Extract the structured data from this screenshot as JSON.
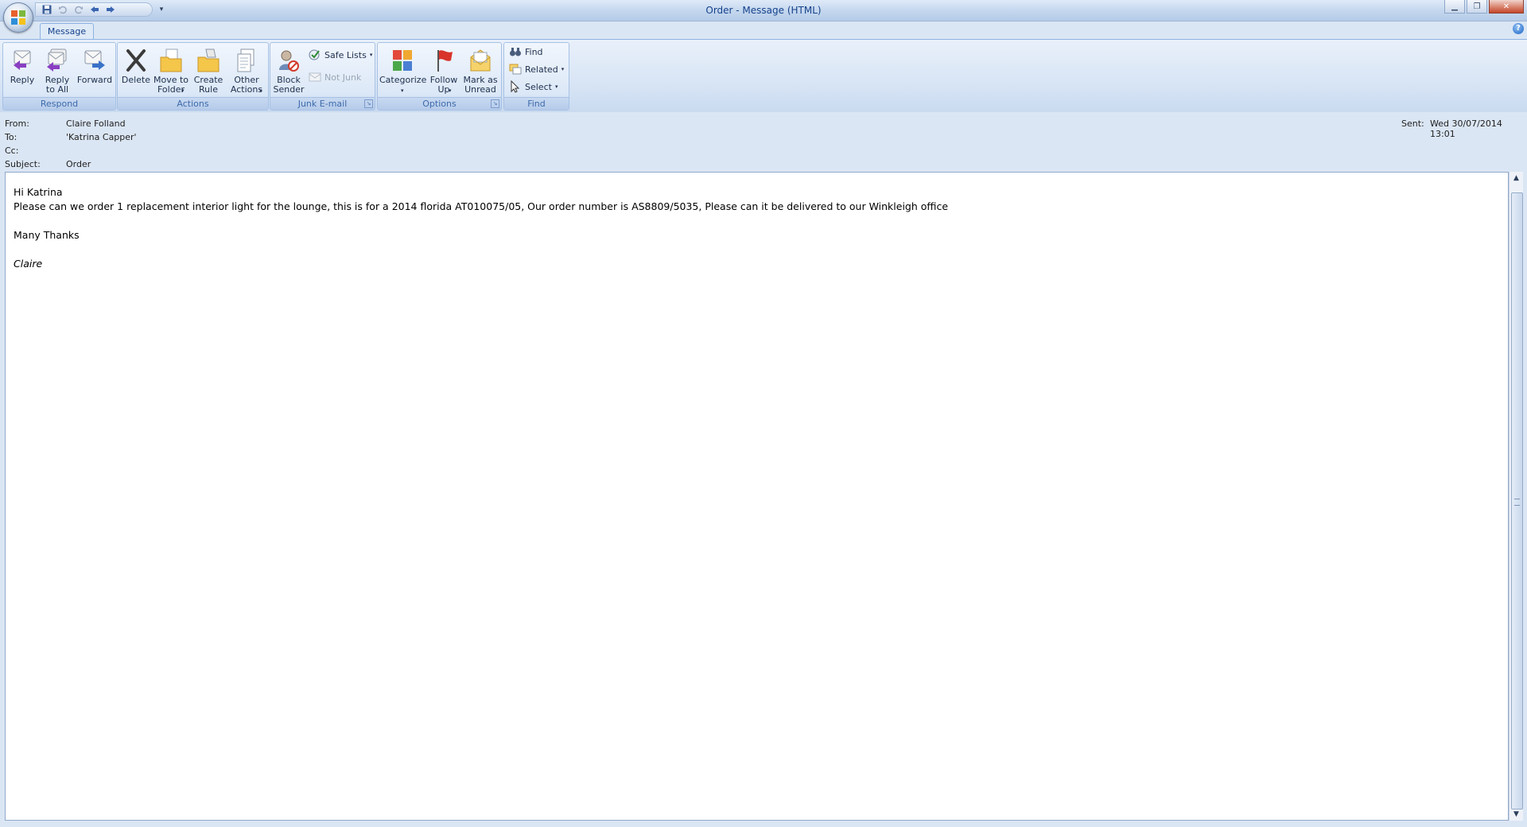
{
  "window": {
    "title": "Order - Message (HTML)"
  },
  "tabs": [
    {
      "label": "Message"
    }
  ],
  "ribbon": {
    "groups": {
      "respond": {
        "label": "Respond",
        "reply": "Reply",
        "reply_all": "Reply\nto All",
        "forward": "Forward"
      },
      "actions": {
        "label": "Actions",
        "delete": "Delete",
        "move_to_folder": "Move to\nFolder",
        "create_rule": "Create\nRule",
        "other_actions": "Other\nActions"
      },
      "junk": {
        "label": "Junk E-mail",
        "block_sender": "Block\nSender",
        "safe_lists": "Safe Lists",
        "not_junk": "Not Junk"
      },
      "options": {
        "label": "Options",
        "categorize": "Categorize",
        "follow_up": "Follow\nUp",
        "mark_as_unread": "Mark as\nUnread"
      },
      "find": {
        "label": "Find",
        "find": "Find",
        "related": "Related",
        "select": "Select"
      }
    }
  },
  "headers": {
    "from_label": "From:",
    "from_value": "Claire Folland",
    "to_label": "To:",
    "to_value": "'Katrina Capper'",
    "cc_label": "Cc:",
    "cc_value": "",
    "subject_label": "Subject:",
    "subject_value": "Order",
    "sent_label": "Sent:",
    "sent_value": "Wed 30/07/2014 13:01"
  },
  "message": {
    "greeting": "Hi Katrina",
    "line1": "Please can we order 1 replacement interior light for the lounge, this is for a 2014 florida AT010075/05, Our order number is AS8809/5035, Please can it be delivered to our Winkleigh office",
    "thanks": "Many Thanks",
    "signature": "Claire"
  },
  "icons": {
    "reply": "reply-icon",
    "reply_all": "reply-all-icon",
    "forward": "forward-icon",
    "delete": "delete-icon",
    "move": "folder-icon",
    "rule": "create-rule-icon",
    "other": "other-actions-icon",
    "block": "block-sender-icon",
    "categorize": "categorize-icon",
    "follow": "flag-icon",
    "unread": "envelope-icon"
  },
  "colors": {
    "accent": "#15428b",
    "ribbon_group_label": "#3e6aaa",
    "close_button": "#c4472c"
  }
}
